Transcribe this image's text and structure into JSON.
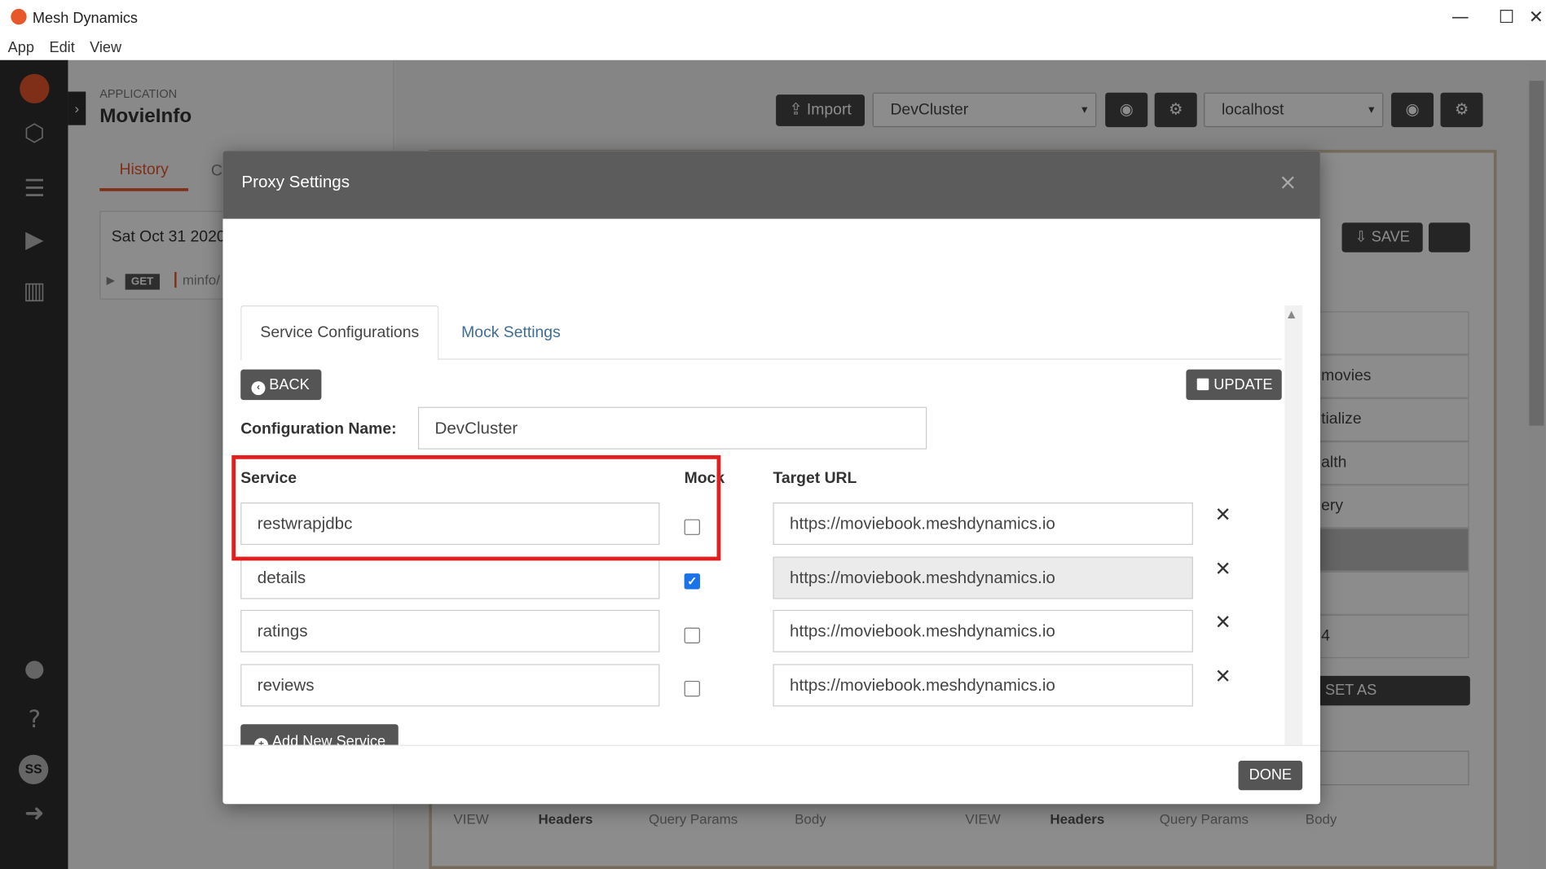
{
  "window": {
    "title": "Mesh Dynamics",
    "minimize": "—",
    "maximize": "☐",
    "close": "✕"
  },
  "menu": [
    "App",
    "Edit",
    "View"
  ],
  "sidebar": {
    "icons": [
      "brand-logo-icon",
      "cube-icon",
      "list-icon",
      "play-icon",
      "chart-icon",
      "chat-icon",
      "help-icon",
      "logout-icon"
    ],
    "avatar": "SS"
  },
  "background": {
    "app_label": "APPLICATION",
    "app_name": "MovieInfo",
    "tabs": [
      "History",
      "C"
    ],
    "history_date": "Sat Oct 31 2020",
    "history_method": "GET",
    "history_path": "minfo/",
    "import_label": "Import",
    "cluster_select": "DevCluster",
    "host_select": "localhost",
    "save_label": "SAVE",
    "set_reference_label": "SET AS REFERENCE",
    "rows": [
      "movies",
      "tialize",
      "alth",
      "ery",
      "",
      "",
      "4"
    ],
    "view_left": {
      "label": "VIEW",
      "options": [
        "Headers",
        "Query Params",
        "Body"
      ],
      "selected": "Query Params"
    },
    "view_right": {
      "label": "VIEW",
      "options": [
        "Headers",
        "Query Params",
        "Body"
      ]
    }
  },
  "modal": {
    "title": "Proxy Settings",
    "close": "×",
    "tabs": {
      "active": "Service Configurations",
      "inactive": "Mock Settings"
    },
    "back_label": "BACK",
    "update_label": "UPDATE",
    "config_name_label": "Configuration Name:",
    "config_name_value": "DevCluster",
    "columns": {
      "service": "Service",
      "mock": "Mock",
      "target_url": "Target URL"
    },
    "services": [
      {
        "name": "restwrapjdbc",
        "mock": false,
        "url": "https://moviebook.meshdynamics.io"
      },
      {
        "name": "details",
        "mock": true,
        "url": "https://moviebook.meshdynamics.io"
      },
      {
        "name": "ratings",
        "mock": false,
        "url": "https://moviebook.meshdynamics.io"
      },
      {
        "name": "reviews",
        "mock": false,
        "url": "https://moviebook.meshdynamics.io"
      }
    ],
    "remove_symbol": "✕",
    "add_service_label": "Add New Service",
    "done_label": "DONE"
  },
  "colors": {
    "accent": "#e8572a",
    "highlight": "#e02020",
    "checkbox": "#1a73e8"
  }
}
